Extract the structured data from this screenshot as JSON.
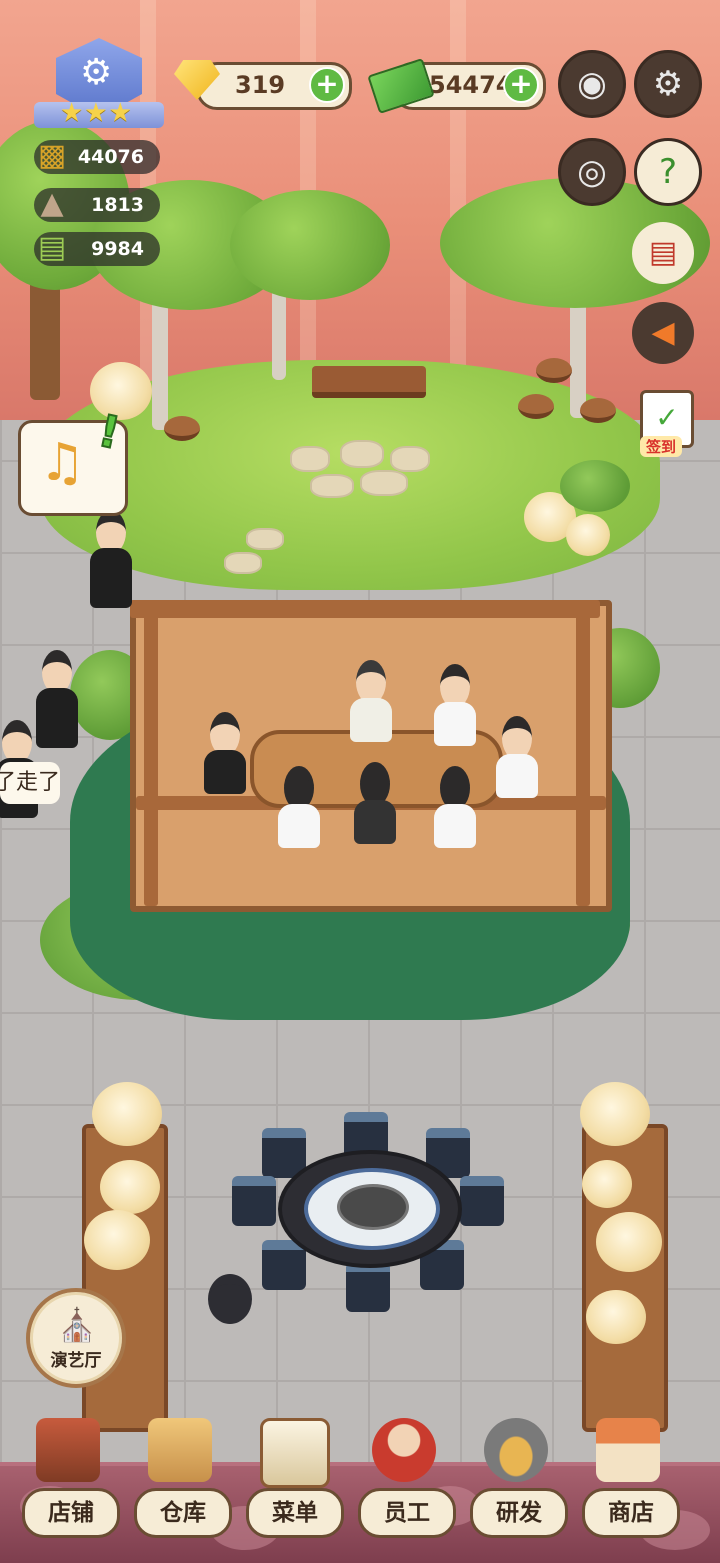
{
  "hud": {
    "gems": "319",
    "cash": "54474",
    "plus_symbol": "+"
  },
  "stats": [
    {
      "icon": "gold-ingot-icon",
      "value": "44076"
    },
    {
      "icon": "cloche-dish-icon",
      "value": "1813"
    },
    {
      "icon": "recipe-book-icon",
      "value": "9984"
    }
  ],
  "check_in": {
    "label": "签到"
  },
  "npc_speech": "了走了",
  "performance_hall": {
    "label": "演艺厅"
  },
  "bottom_nav": [
    {
      "label": "店铺",
      "icon": "storefront-icon"
    },
    {
      "label": "仓库",
      "icon": "warehouse-boxes-icon"
    },
    {
      "label": "菜单",
      "icon": "menu-clipboard-icon"
    },
    {
      "label": "员工",
      "icon": "staff-icon"
    },
    {
      "label": "研发",
      "icon": "research-wok-icon"
    },
    {
      "label": "商店",
      "icon": "shop-stall-icon"
    }
  ],
  "colors": {
    "wall": "#e98e78",
    "garden": "#92c64a",
    "hud_pill": "#f6ecd6",
    "plus_button": "#5fba43",
    "bottom_bar": "#7e3e4e"
  }
}
